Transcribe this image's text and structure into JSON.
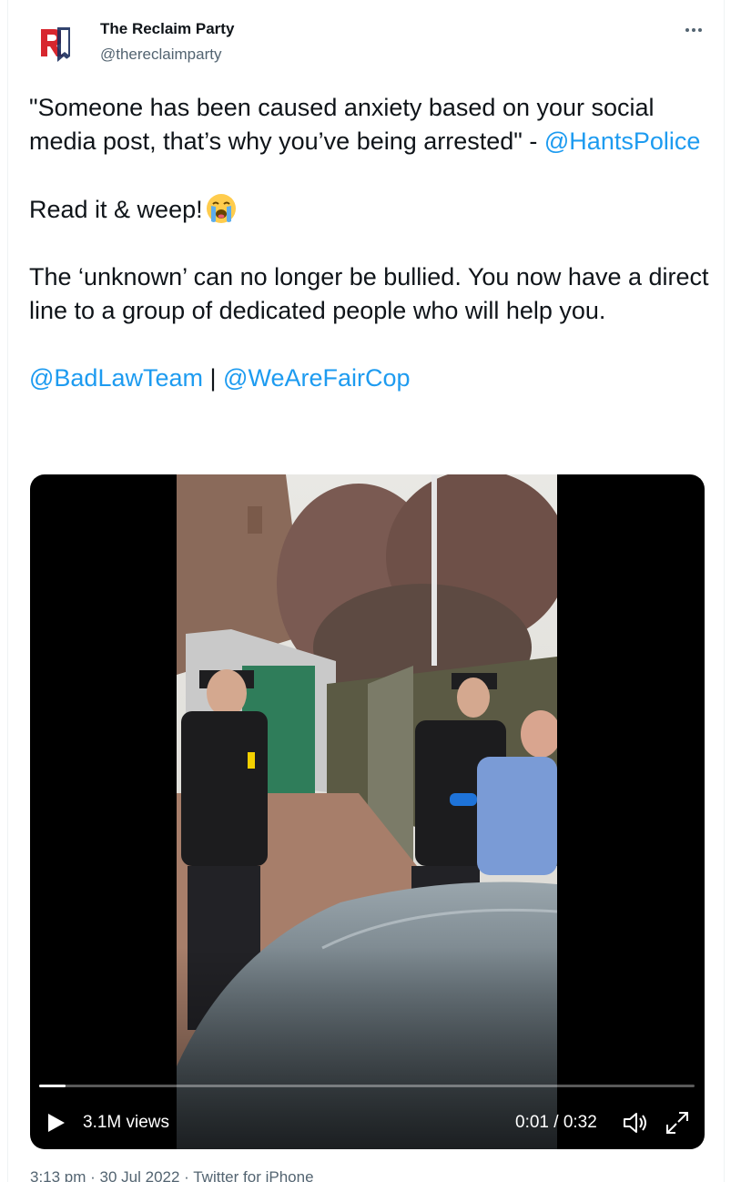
{
  "author": {
    "name": "The Reclaim Party",
    "handle": "@thereclaimparty"
  },
  "tweet": {
    "line1_pre": "\"Someone has been caused anxiety based on your social media post, that’s why you’ve being arrested\" - ",
    "mention_police": "@HantsPolice",
    "line2": "Read it & weep!",
    "line2_emoji": "loudly-crying-face-emoji",
    "line3": "The ‘unknown’ can no longer be bullied. You now have a direct line to a group of dedicated people who will help you.",
    "mention_badlaw": "@BadLawTeam",
    "separator": " | ",
    "mention_faircop": "@WeAreFairCop"
  },
  "video": {
    "views": "3.1M views",
    "current_time": "0:01",
    "time_separator": " / ",
    "duration": "0:32",
    "progress": 0.04,
    "icons": [
      "play-icon",
      "volume-icon",
      "fullscreen-icon"
    ]
  },
  "meta": {
    "text": "3:13 pm · 30 Jul 2022 · Twitter for iPhone"
  },
  "colors": {
    "link": "#1d9bf0",
    "text": "#0f1419",
    "secondary": "#536471",
    "brand_red": "#d7262e",
    "brand_navy": "#1c2f5e"
  }
}
